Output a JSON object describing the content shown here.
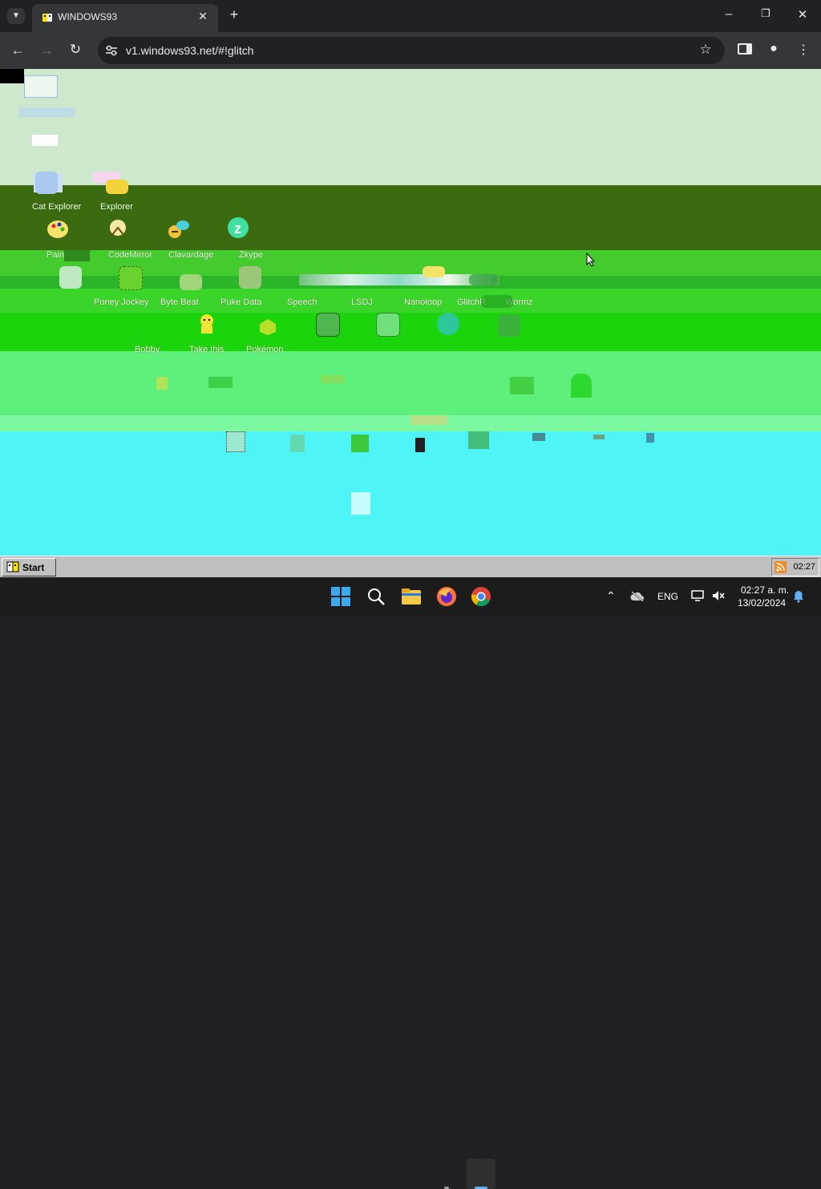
{
  "browser": {
    "tab_title": "WINDOWS93",
    "url": "v1.windows93.net/#!glitch",
    "icons": [
      "tab-list-icon",
      "favicon-icon",
      "close-tab-icon",
      "new-tab-icon",
      "minimize-icon",
      "restore-icon",
      "close-window-icon",
      "back-icon",
      "forward-icon",
      "reload-icon",
      "site-info-icon",
      "bookmark-star-icon",
      "side-panel-icon",
      "profile-icon",
      "menu-icon"
    ]
  },
  "desktop": {
    "icons_row1": [
      {
        "label": "Cat Explorer",
        "icon": "cat-explorer-icon"
      },
      {
        "label": "Explorer",
        "icon": "explorer-folder-icon"
      }
    ],
    "icons_row2": [
      {
        "label": "Paint",
        "icon": "paint-palette-icon"
      },
      {
        "label": "CodeMirror",
        "icon": "codemirror-icon"
      },
      {
        "label": "Clavardage",
        "icon": "chat-icon"
      },
      {
        "label": "Zkype",
        "icon": "zkype-icon"
      }
    ],
    "icons_row3": [
      {
        "label": "Poney Jockey",
        "icon": "poney-icon"
      },
      {
        "label": "Byte Beat",
        "icon": "bytebeat-icon"
      },
      {
        "label": "Puke Data",
        "icon": "puke-data-icon"
      },
      {
        "label": "Speech",
        "icon": "speech-icon"
      },
      {
        "label": "LSDJ",
        "icon": "lsdj-icon"
      },
      {
        "label": "Nanoloop",
        "icon": "nanoloop-icon"
      },
      {
        "label": "GlitchR",
        "icon": "glitch-icon"
      },
      {
        "label": "Wormz",
        "icon": "wormz-icon"
      }
    ],
    "icons_row4": [
      {
        "label": "Bobby",
        "icon": "bobby-icon"
      },
      {
        "label": "Take this",
        "icon": "take-this-icon"
      },
      {
        "label": "Pokémon",
        "icon": "pokemon-icon"
      }
    ]
  },
  "w93_taskbar": {
    "start_label": "Start",
    "clock": "02:27"
  },
  "win_taskbar": {
    "language": "ENG",
    "time": "02:27 a. m.",
    "date": "13/02/2024"
  },
  "colors": {
    "band_light": "#cde8cc",
    "band_dark": "#3b6a11",
    "band_green": "#44cc2f",
    "band_bright": "#1bd40b",
    "band_mint": "#5ef07a",
    "cyan": "#4ff5f6"
  }
}
